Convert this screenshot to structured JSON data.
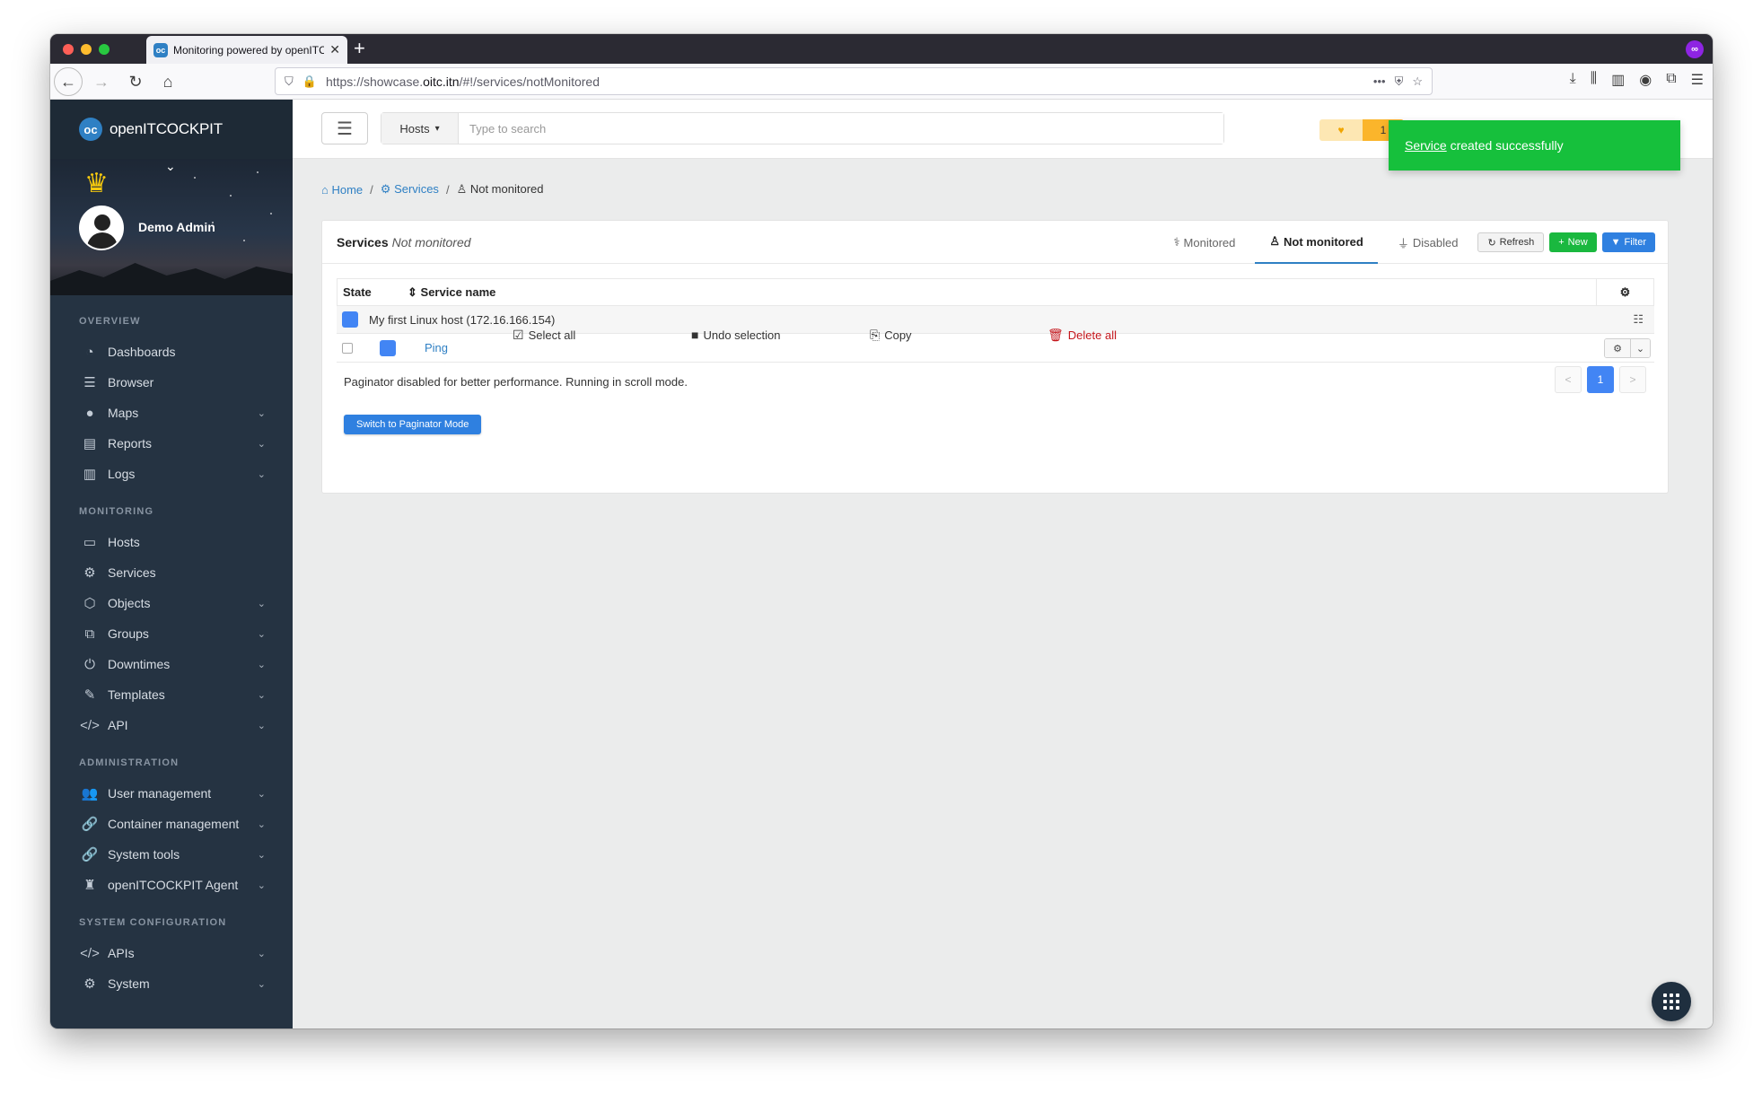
{
  "browser": {
    "tab_title": "Monitoring powered by openITC",
    "tab_favicon": "oc",
    "new_tab": "+",
    "url_prefix": "https://showcase.",
    "url_domain": "oitc.itn",
    "url_path": "/#!/services/notMonitored",
    "private_icon": "∞"
  },
  "sidebar": {
    "logo_badge": "oc",
    "logo_text": "openITCOCKPIT",
    "user_name": "Demo Admin",
    "sections": [
      {
        "title": "OVERVIEW",
        "items": [
          {
            "label": "Dashboards",
            "icon": "dashboard-icon",
            "glyph": "◔",
            "chev": false
          },
          {
            "label": "Browser",
            "icon": "list-icon",
            "glyph": "☰",
            "chev": false
          },
          {
            "label": "Maps",
            "icon": "map-marker-icon",
            "glyph": "●",
            "chev": true
          },
          {
            "label": "Reports",
            "icon": "file-icon",
            "glyph": "▤",
            "chev": true
          },
          {
            "label": "Logs",
            "icon": "file-text-icon",
            "glyph": "▥",
            "chev": true
          }
        ]
      },
      {
        "title": "MONITORING",
        "items": [
          {
            "label": "Hosts",
            "icon": "desktop-icon",
            "glyph": "▭",
            "chev": false
          },
          {
            "label": "Services",
            "icon": "cogs-icon",
            "glyph": "⚙",
            "chev": false
          },
          {
            "label": "Objects",
            "icon": "cubes-icon",
            "glyph": "⬡",
            "chev": true
          },
          {
            "label": "Groups",
            "icon": "object-group-icon",
            "glyph": "⧉",
            "chev": true
          },
          {
            "label": "Downtimes",
            "icon": "power-icon",
            "glyph": "⏻",
            "chev": true
          },
          {
            "label": "Templates",
            "icon": "edit-icon",
            "glyph": "✎",
            "chev": true
          },
          {
            "label": "API",
            "icon": "code-icon",
            "glyph": "</>",
            "chev": true
          }
        ]
      },
      {
        "title": "ADMINISTRATION",
        "items": [
          {
            "label": "User management",
            "icon": "users-icon",
            "glyph": "👥",
            "chev": true
          },
          {
            "label": "Container management",
            "icon": "link-icon",
            "glyph": "🔗",
            "chev": true
          },
          {
            "label": "System tools",
            "icon": "wrench-icon",
            "glyph": "🔗",
            "chev": true
          },
          {
            "label": "openITCOCKPIT Agent",
            "icon": "user-secret-icon",
            "glyph": "♜",
            "chev": true
          }
        ]
      },
      {
        "title": "SYSTEM CONFIGURATION",
        "items": [
          {
            "label": "APIs",
            "icon": "code-icon",
            "glyph": "</>",
            "chev": true
          },
          {
            "label": "System",
            "icon": "cogs-icon",
            "glyph": "⚙",
            "chev": true
          }
        ]
      }
    ]
  },
  "topbar": {
    "search_type": "Hosts",
    "search_placeholder": "Type to search",
    "status_count": "1"
  },
  "toast": {
    "link": "Service",
    "message": " created successfully"
  },
  "breadcrumb": {
    "home": "Home",
    "sep": "/",
    "services": "Services",
    "current": "Not monitored"
  },
  "panel": {
    "title": "Services",
    "subtitle": "Not monitored",
    "tabs": {
      "monitored": "Monitored",
      "not_monitored": "Not monitored",
      "disabled": "Disabled"
    },
    "buttons": {
      "refresh": "Refresh",
      "new": "New",
      "filter": "Filter"
    },
    "table": {
      "col_state": "State",
      "col_name": "Service name",
      "host": "My first Linux host (172.16.166.154)",
      "services": [
        {
          "name": "Ping",
          "state_color": "#4285f4"
        }
      ]
    },
    "mass_actions": {
      "select_all": "Select all",
      "undo": "Undo selection",
      "copy": "Copy",
      "delete_all": "Delete all"
    },
    "paginator_text": "Paginator disabled for better performance. Running in scroll mode.",
    "pager": {
      "prev": "<",
      "page": "1",
      "next": ">"
    },
    "switch_button": "Switch to Paginator Mode"
  },
  "colors": {
    "accent": "#2f80c4",
    "success": "#16c03c",
    "sidebar_bg": "#253342",
    "state_blue": "#4285f4",
    "danger": "#c4161c"
  }
}
